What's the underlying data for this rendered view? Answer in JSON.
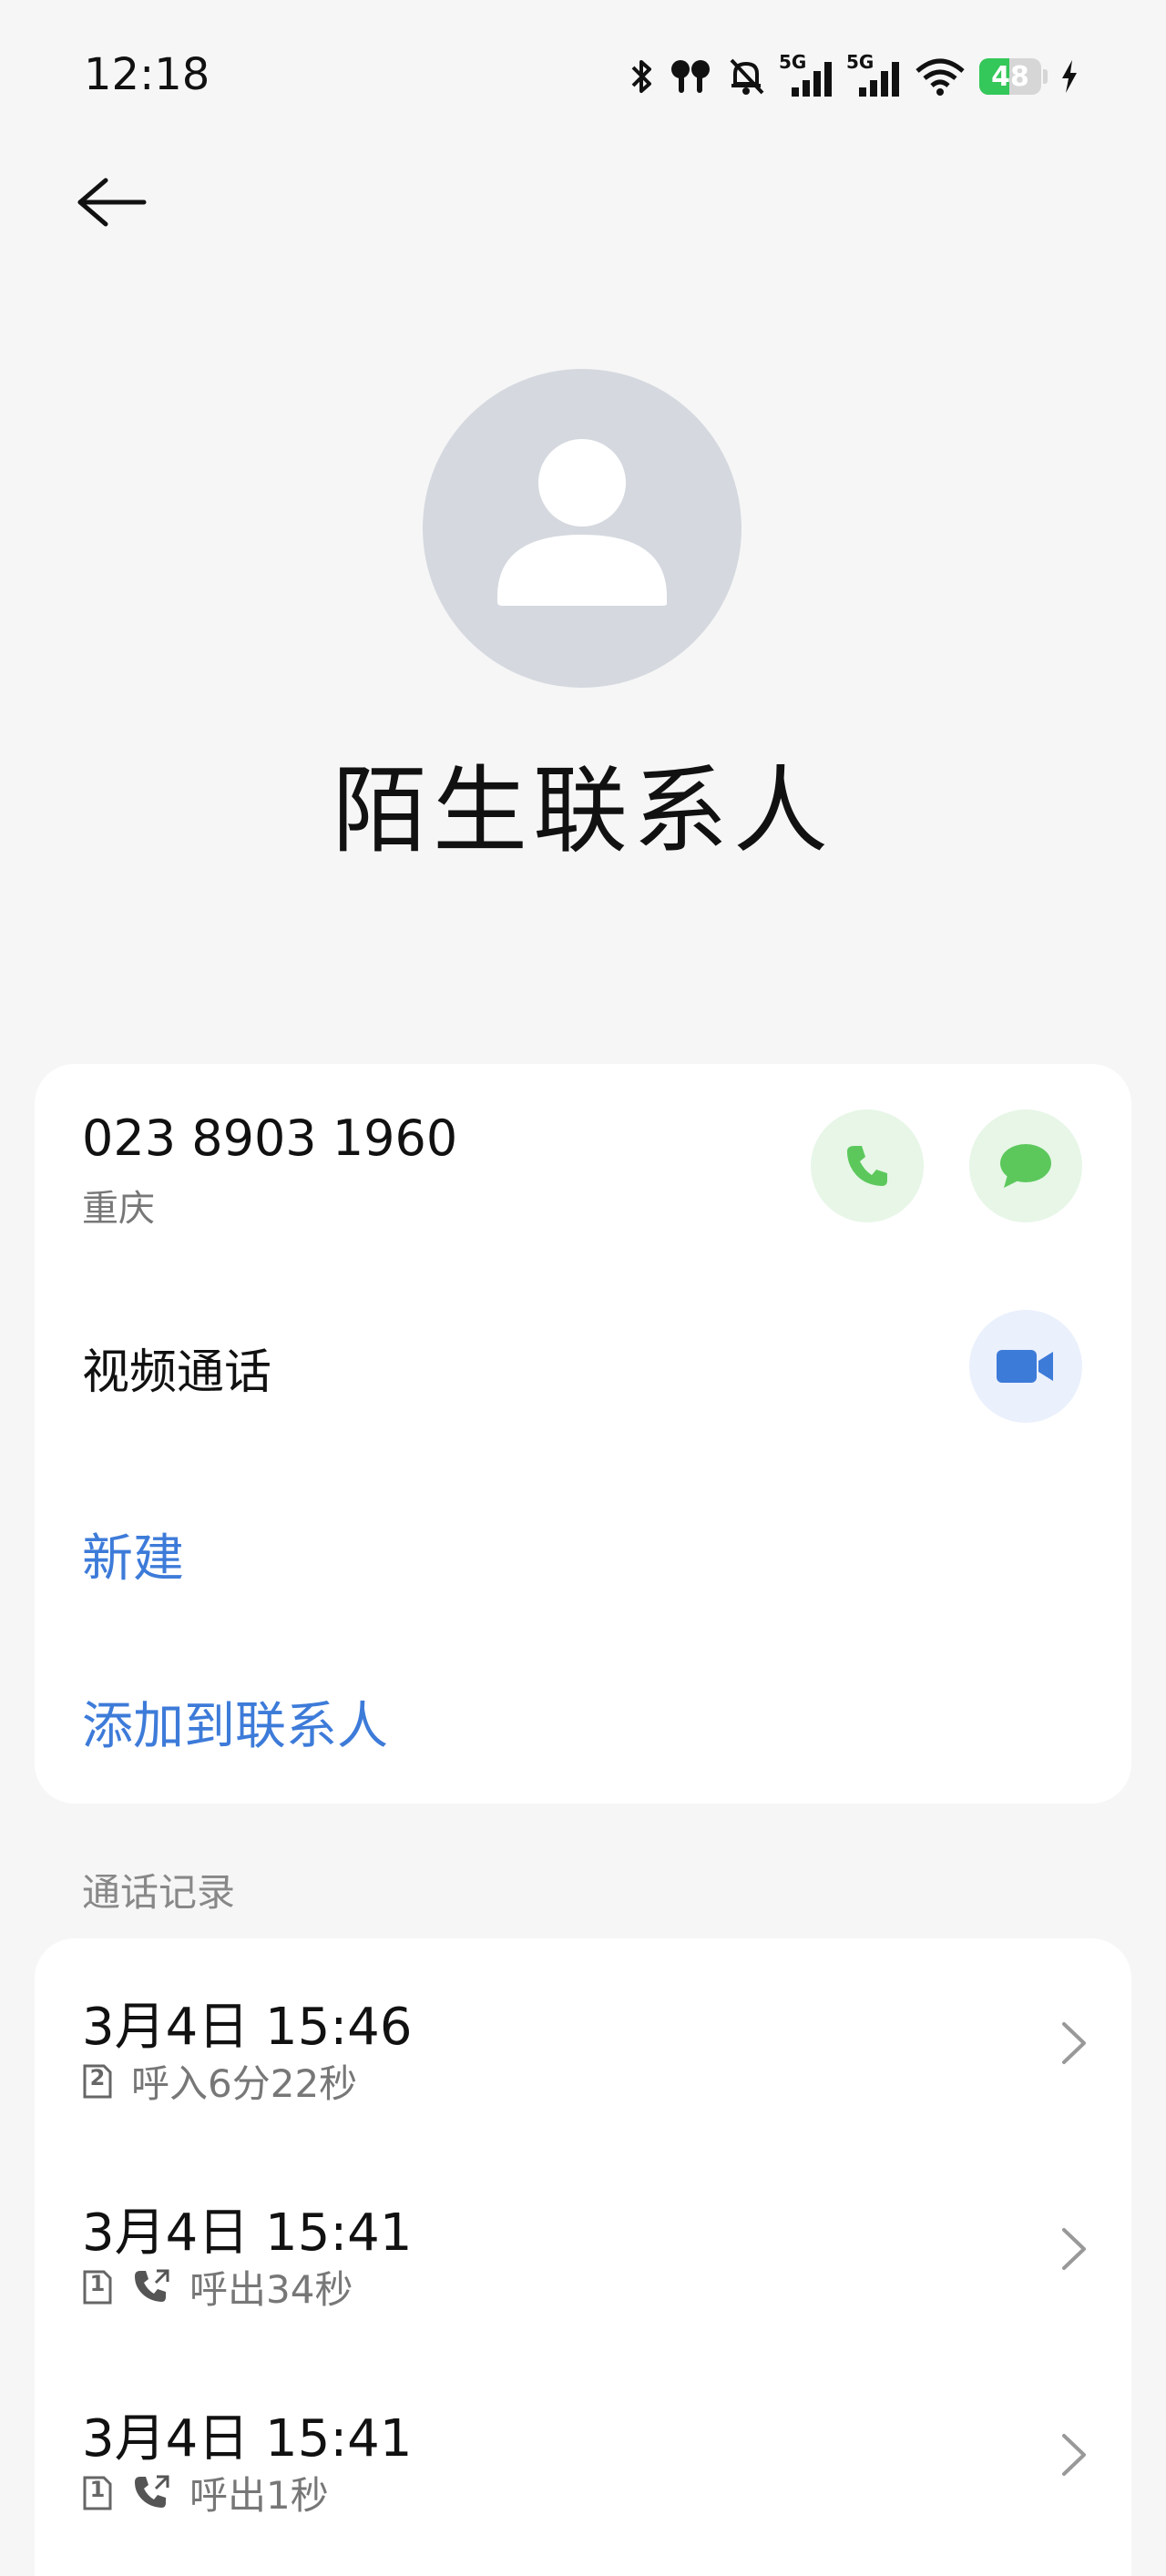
{
  "status_bar": {
    "time": "12:18",
    "network_5g_1": "5G",
    "network_5g_2": "5G",
    "battery_level": "48",
    "battery_percent": 48,
    "icons": [
      "bluetooth-icon",
      "earbuds-icon",
      "silent-bell-icon",
      "signal-5g-icon",
      "signal-5g-icon",
      "wifi-icon",
      "battery-icon",
      "charging-icon"
    ]
  },
  "header": {
    "back_icon": "arrow-left-icon"
  },
  "contact": {
    "name": "陌生联系人",
    "phone": "023 8903 1960",
    "location": "重庆"
  },
  "actions": {
    "video_call_label": "视频通话",
    "new_label": "新建",
    "add_to_contacts_label": "添加到联系人"
  },
  "call_log": {
    "title": "通话记录",
    "entries": [
      {
        "time": "3月4日 15:46",
        "sim": "2",
        "type": "incoming",
        "detail": "呼入6分22秒"
      },
      {
        "time": "3月4日 15:41",
        "sim": "1",
        "type": "outgoing",
        "detail": "呼出34秒"
      },
      {
        "time": "3月4日 15:41",
        "sim": "1",
        "type": "outgoing",
        "detail": "呼出1秒"
      }
    ]
  },
  "colors": {
    "background": "#f6f6f6",
    "card": "#ffffff",
    "accent_blue": "#3d7bd9",
    "call_green": "#5cc85c",
    "battery_green": "#34c759",
    "avatar_gray": "#d5d9df"
  }
}
